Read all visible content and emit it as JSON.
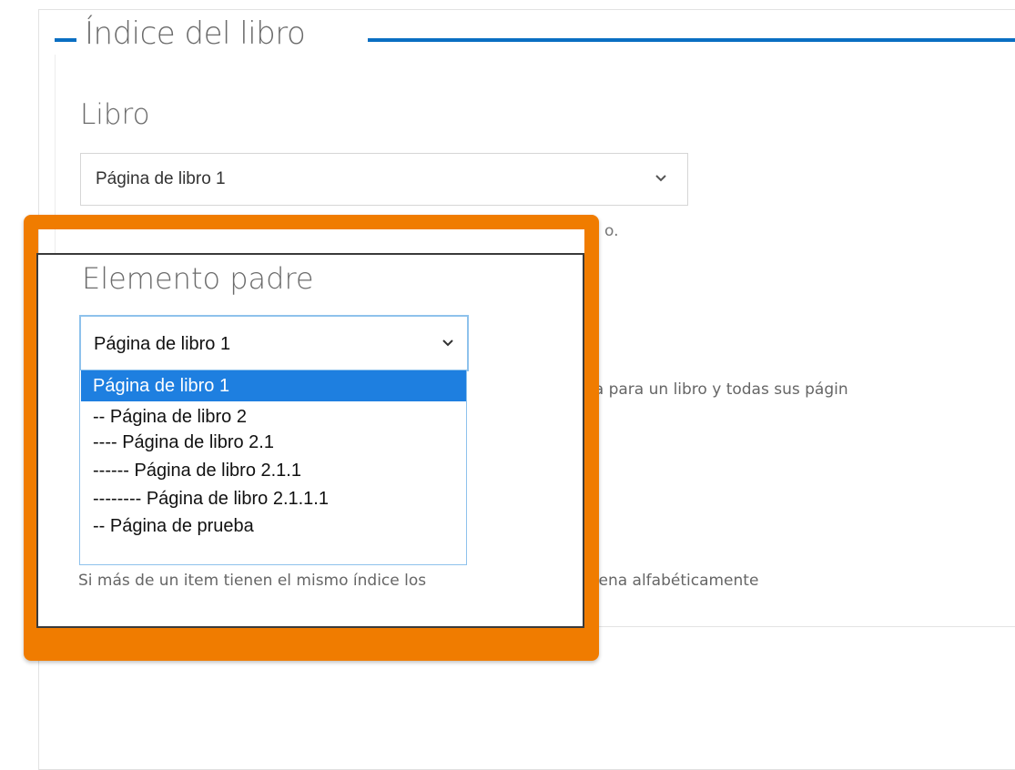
{
  "fieldset": {
    "legend": "Índice del libro"
  },
  "libro": {
    "label": "Libro",
    "selected": "Página de libro 1",
    "help_fragment": "o."
  },
  "padre": {
    "label": "Elemento padre",
    "selected": "Página de libro 1",
    "options": [
      "Página de libro 1",
      "-- Página de libro 2",
      "---- Página de libro 2.1",
      "------ Página de libro 2.1.1",
      "-------- Página de libro 2.1.1.1",
      "-- Página de prueba"
    ],
    "highlighted_index": 0,
    "depth_help_visible": "fundidad máxima para un libro y todas sus págin"
  },
  "peso": {
    "help_visible_left": "Si más de un item tienen el mismo índice los",
    "help_visible_right": "rdena alfabéticamente"
  },
  "icons": {
    "select_arrow": "chevron-down-icon"
  },
  "colors": {
    "accent_blue": "#0a6fc2",
    "highlight_orange": "#f07c00",
    "selected_option_bg": "#1e7fe0",
    "focus_border": "#8ec2ec"
  }
}
